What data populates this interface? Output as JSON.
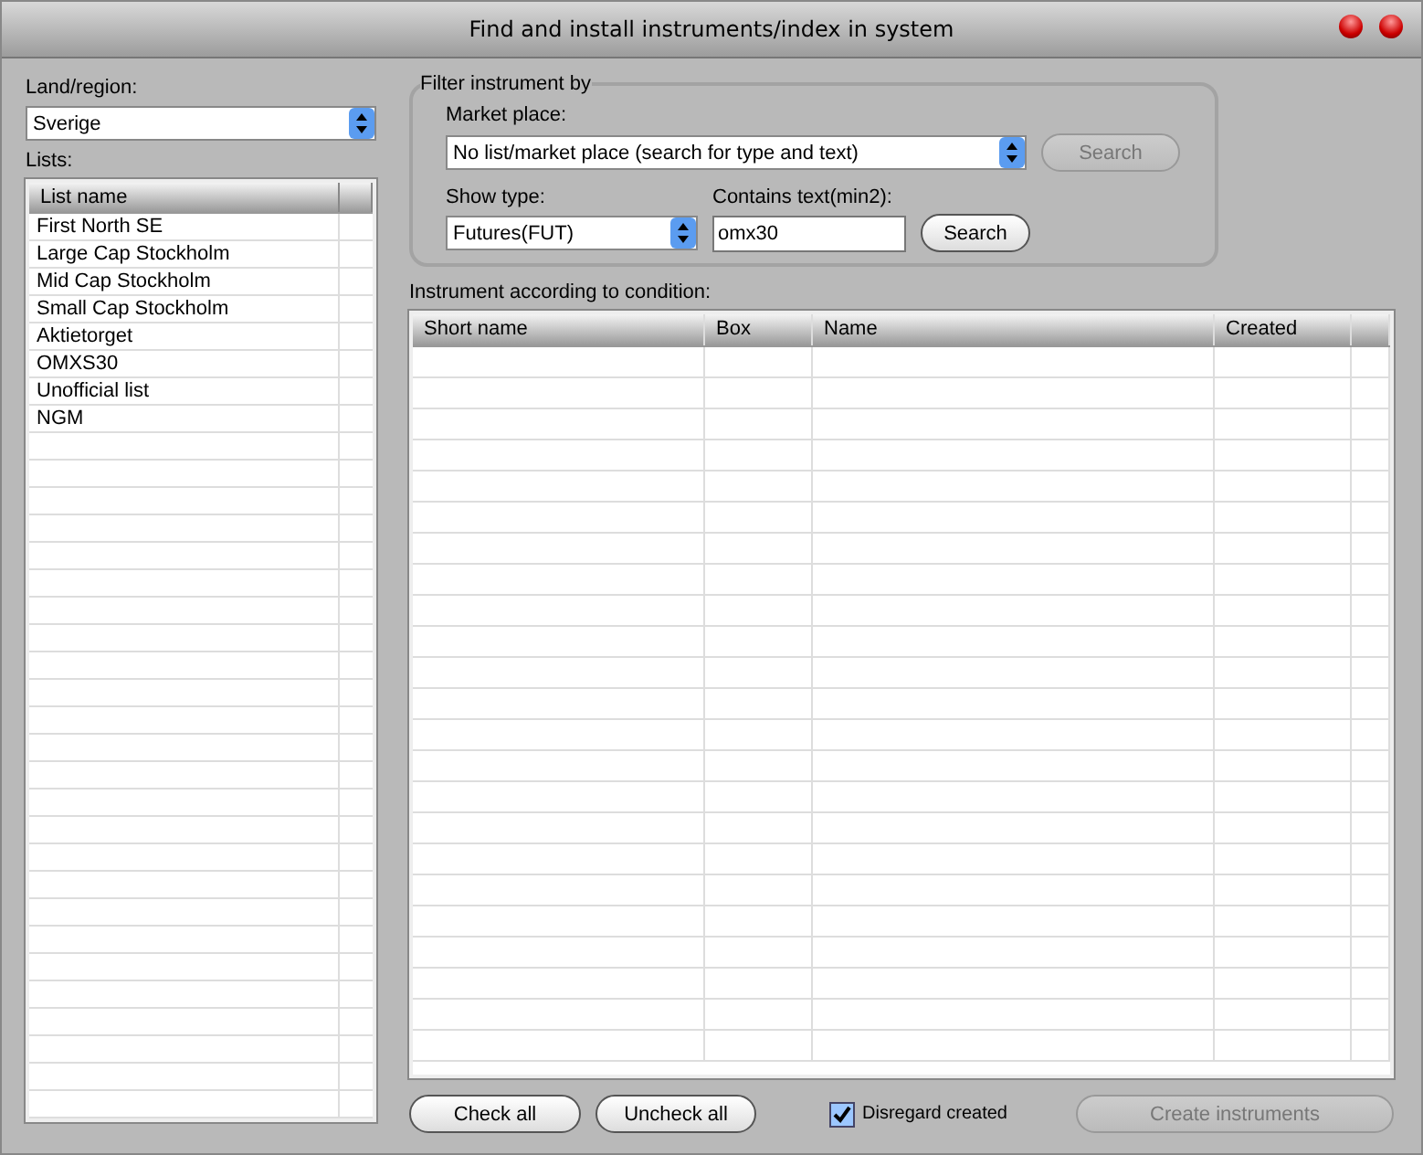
{
  "window": {
    "title": "Find and install instruments/index in system"
  },
  "region": {
    "label": "Land/region:",
    "value": "Sverige"
  },
  "lists": {
    "label": "Lists:",
    "column": "List name",
    "items": [
      "First North SE",
      "Large Cap Stockholm",
      "Mid Cap Stockholm",
      "Small Cap Stockholm",
      "Aktietorget",
      "OMXS30",
      "Unofficial list",
      "NGM"
    ]
  },
  "filter": {
    "title": "Filter instrument by",
    "market_label": "Market place:",
    "market_value": "No list/market place (search for type and text)",
    "market_search": {
      "label": "Search",
      "disabled": true
    },
    "type_label": "Show type:",
    "type_value": "Futures(FUT)",
    "text_label": "Contains text(min2):",
    "text_value": "omx30",
    "text_search": {
      "label": "Search",
      "disabled": false
    }
  },
  "results": {
    "label": "Instrument according to condition:",
    "columns": [
      "Short name",
      "Box",
      "Name",
      "Created"
    ]
  },
  "footer": {
    "check_all": {
      "label": "Check all",
      "disabled": false
    },
    "uncheck_all": {
      "label": "Uncheck all",
      "disabled": false
    },
    "disregard": {
      "label": "Disregard created",
      "checked": true
    },
    "create": {
      "label": "Create instruments",
      "disabled": true
    }
  }
}
